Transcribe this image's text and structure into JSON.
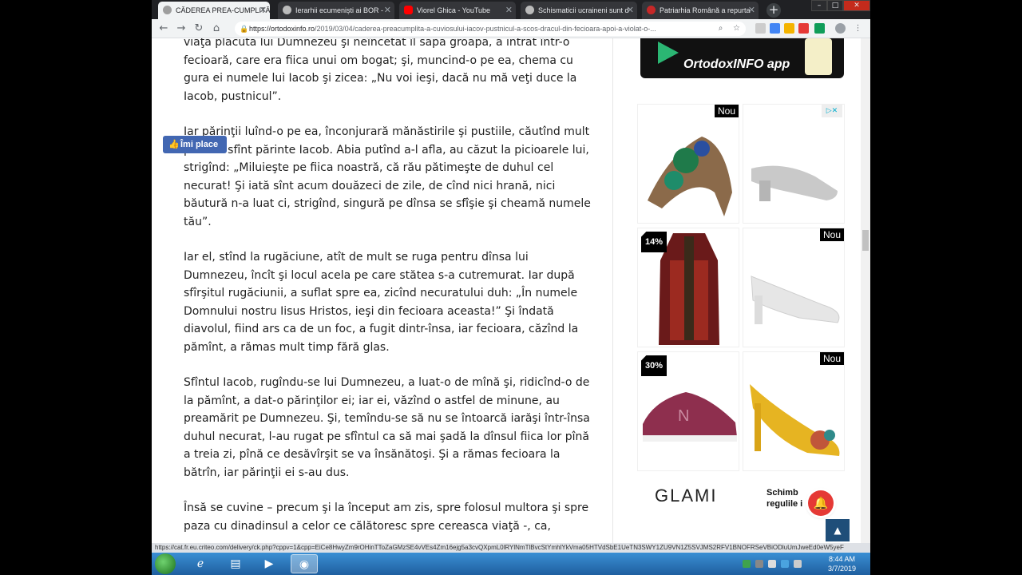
{
  "tabs": [
    {
      "title": "CĂDEREA PREA-CUMPLITĂ a",
      "active": true,
      "icon": "ortodoxinfo-favicon"
    },
    {
      "title": "Ierarhii ecumeniști ai BOR -",
      "active": false,
      "icon": "page-favicon"
    },
    {
      "title": "Viorel Ghica - YouTube",
      "active": false,
      "icon": "youtube-favicon"
    },
    {
      "title": "Schismaticii ucraineni sunt d",
      "active": false,
      "icon": "page-favicon"
    },
    {
      "title": "Patriarhia Română a repurta",
      "active": false,
      "icon": "patriarhia-favicon"
    }
  ],
  "window": {
    "minimize": "–",
    "maximize": "□",
    "close": "✕",
    "new_tab": "+"
  },
  "toolbar": {
    "back": "←",
    "forward": "→",
    "reload": "↻",
    "home": "⌂",
    "url_host": "https://ortodoxinfo.ro",
    "url_path": "/2019/03/04/caderea-preacumplita-a-cuviosului-iacov-pustnicul-a-scos-dracul-din-fecioara-apoi-a-violat-o-..."
  },
  "article": {
    "paragraphs": [
      "viaţa plăcută lui Dumnezeu şi neîncetat îl săpa groapa, a intrat într-o fecioară, care era fiica unui om bogat; şi, muncind-o pe ea, chema cu gura ei numele lui Iacob şi zicea: „Nu voi ieşi, dacă nu mă veţi duce la Iacob, pustnicul”.",
      "Iar părinţii luînd-o pe ea, înconjurară mănăstirile şi pustiile, căutînd mult pe acel sfînt părinte Iacob. Abia putînd a-l afla, au căzut la picioarele lui, strigînd: „Miluieşte pe fiica noastră, că rău pătimeşte de duhul cel necurat! Şi iată sînt acum douăzeci de zile, de cînd nici hrană, nici băutură n-a luat ci, strigînd, singură pe dînsa se sfîşie şi cheamă numele tău”.",
      "Iar el, stînd la rugăciune, atît de mult se ruga pentru dînsa lui Dumnezeu, încît şi locul acela pe care stătea s-a cutremurat. Iar după sfîrşitul rugăciunii, a suflat spre ea, zicînd necuratului duh: „În numele Domnului nostru Iisus Hristos, ieşi din fecioara aceasta!” Şi îndată diavolul, fiind ars ca de un foc, a fugit dintr-însa, iar fecioara, căzînd la pămînt, a rămas mult timp fără glas.",
      "Sfîntul Iacob, rugîndu-se lui Dumnezeu, a luat-o de mînă şi, ridicînd-o de la pămînt, a dat-o părinţilor ei; iar ei, văzînd o astfel de minune, au preamărit pe Dumnezeu. Şi, temîndu-se să nu se întoarcă iarăşi într-însa duhul necurat, l-au rugat pe sfîntul ca să mai şadă la dînsul fiica lor pînă a treia zi, pînă ce desăvîrşit se va însănătoşi. Şi a rămas fecioara la bătrîn, iar părinţii ei s-au dus.",
      "Însă se cuvine – precum şi la început am zis, spre folosul multora şi spre paza cu dinadinsul a celor ce călătoresc spre cereasca viaţă -, ca,"
    ]
  },
  "like_button": {
    "label": "Îmi place",
    "icon": "thumbs-up-icon"
  },
  "app_banner": {
    "label": "OrtodoxINFO app",
    "icon": "google-play-icon"
  },
  "ad": {
    "adchoice": "▷✕",
    "cells": [
      {
        "name": "ad-item-jeweled-sandal",
        "badge": "Nou",
        "badge_type": "nou",
        "image": "jeweled-heel-sandal-image"
      },
      {
        "name": "ad-item-silver-sandal",
        "badge": "",
        "badge_type": "none",
        "image": "silver-block-heel-sandal-image"
      },
      {
        "name": "ad-item-patterned-coat",
        "badge": "14%",
        "badge_type": "discount",
        "image": "patterned-coat-image"
      },
      {
        "name": "ad-item-white-pump",
        "badge": "Nou",
        "badge_type": "nou",
        "image": "white-slingback-pump-image"
      },
      {
        "name": "ad-item-burgundy-sneaker",
        "badge": "30%",
        "badge_type": "discount",
        "image": "burgundy-sneaker-image"
      },
      {
        "name": "ad-item-yellow-heel",
        "badge": "Nou",
        "badge_type": "nou",
        "image": "yellow-slingback-heel-image"
      }
    ],
    "brand": "GLAMI",
    "cta_line1": "Schimb",
    "cta_line2": "regulile i"
  },
  "notification_bell": {
    "icon": "bell-icon"
  },
  "back_to_top": {
    "icon": "chevron-up-icon",
    "glyph": "▲"
  },
  "status_url": "https://cat.fr.eu.criteo.com/delivery/ck.php?cppv=1&cpp=EiCe8HwyZm9rOHinTToZaGMzSE4vVEs4Zm16ejg5a3cvQXpmL0lRYlNmTlBvcStYmhlYkVma05HTVdSbE1UeTN3SWY1ZU9VN1Z5SVJMS2RFV1BNOFRSeVBiODluUmJweEd0eW5yeF",
  "taskbar": {
    "apps": [
      "windows-start",
      "internet-explorer",
      "file-explorer",
      "media-player",
      "chrome"
    ],
    "time": "8:44 AM",
    "date": "3/7/2019"
  },
  "colors": {
    "facebook_blue": "#4267b2",
    "bell_red": "#e53935",
    "to_top_blue": "#1f4e79",
    "taskbar_blue": "#2b7bc3"
  }
}
